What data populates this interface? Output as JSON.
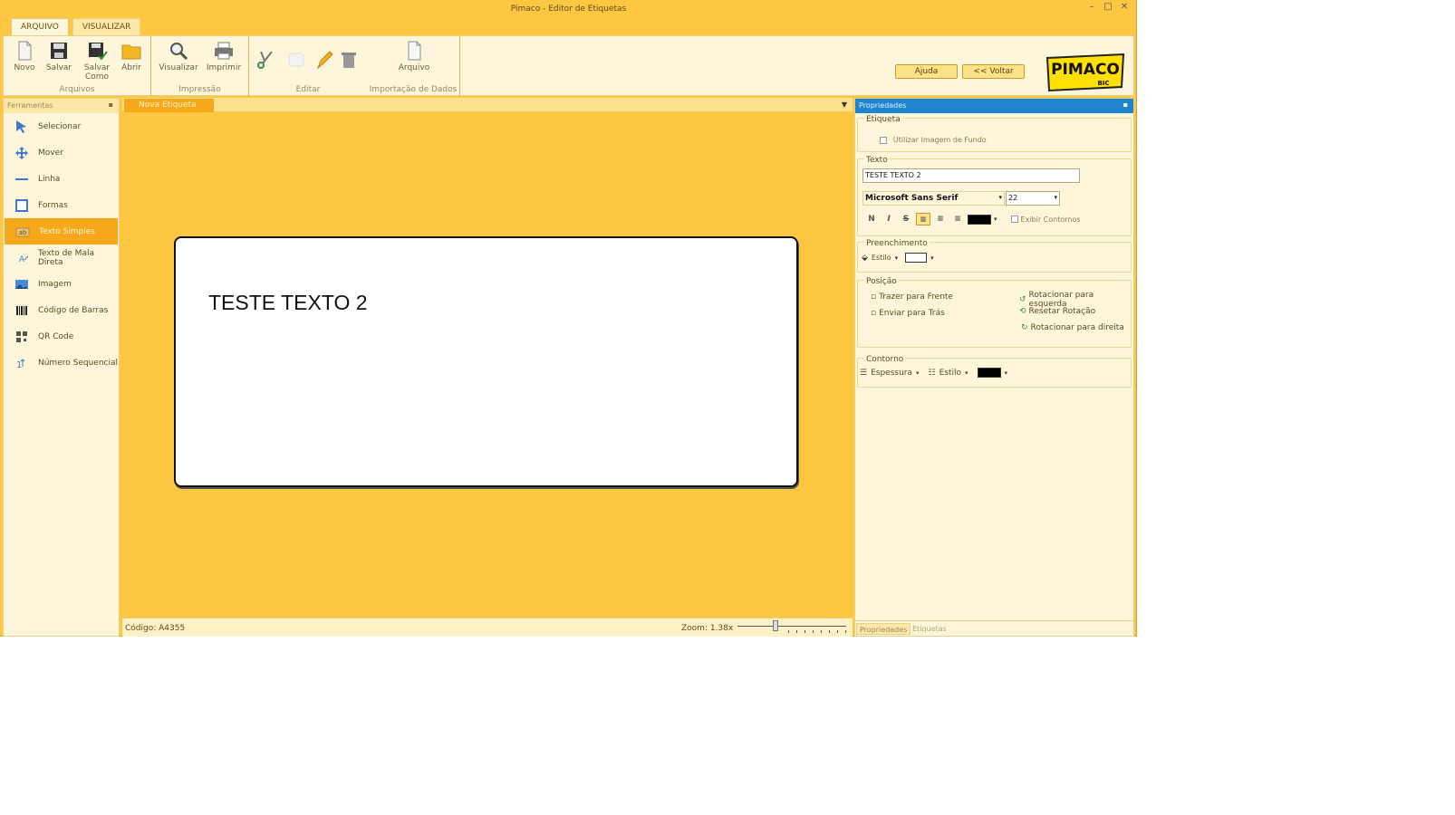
{
  "window": {
    "title": "Pimaco - Editor de Etiquetas",
    "controls": [
      "minimize",
      "maximize",
      "close"
    ]
  },
  "ribbon": {
    "tabs": [
      {
        "label": "ARQUIVO",
        "active": true
      },
      {
        "label": "VISUALIZAR",
        "active": false
      }
    ],
    "groups": {
      "arquivos": {
        "label": "Arquivos",
        "buttons": [
          "Novo",
          "Salvar",
          "Salvar Como",
          "Abrir"
        ]
      },
      "impressao": {
        "label": "Impressão",
        "buttons": [
          "Visualizar",
          "Imprimir"
        ]
      },
      "editar": {
        "label": "Editar"
      },
      "importacao": {
        "label": "Importação de Dados",
        "buttons": [
          "Arquivo"
        ]
      }
    },
    "help_label": "Ajuda",
    "back_label": "<< Voltar",
    "logo_text": "PIMACO",
    "logo_sub": "BIC"
  },
  "tools_panel": {
    "title": "Ferramentas",
    "items": [
      {
        "label": "Selecionar",
        "icon": "cursor-icon",
        "active": false
      },
      {
        "label": "Mover",
        "icon": "move-icon",
        "active": false
      },
      {
        "label": "Linha",
        "icon": "line-icon",
        "active": false
      },
      {
        "label": "Formas",
        "icon": "shape-icon",
        "active": false
      },
      {
        "label": "Texto Simples",
        "icon": "text-icon",
        "active": true
      },
      {
        "label": "Texto de Mala Direta",
        "icon": "mail-merge-icon",
        "active": false
      },
      {
        "label": "Imagem",
        "icon": "image-icon",
        "active": false
      },
      {
        "label": "Código de Barras",
        "icon": "barcode-icon",
        "active": false
      },
      {
        "label": "QR Code",
        "icon": "qrcode-icon",
        "active": false
      },
      {
        "label": "Número Sequencial",
        "icon": "sequence-icon",
        "active": false
      }
    ]
  },
  "document": {
    "tab_label": "Nova Etiqueta",
    "label_text": "TESTE TEXTO 2",
    "status_code": "Código: A4355",
    "status_zoom": "Zoom: 1.38x",
    "zoom_level": 0.38
  },
  "properties": {
    "title": "Propriedades",
    "etiqueta": {
      "title": "Etiqueta",
      "bg_image_label": "Utilizar Imagem de Fundo"
    },
    "texto": {
      "title": "Texto",
      "value": "TESTE TEXTO 2",
      "font": "Microsoft Sans Serif",
      "size": "22",
      "bold": "N",
      "italic": "I",
      "strike": "S",
      "show_outline_label": "Exibir Contornos"
    },
    "preenchimento": {
      "title": "Preenchimento",
      "style_label": "Estilo"
    },
    "posicao": {
      "title": "Posição",
      "bring_front": "Trazer para Frente",
      "send_back": "Enviar para Trás",
      "rotate_left": "Rotacionar para esquerda",
      "reset_rotation": "Resetar Rotação",
      "rotate_right": "Rotacionar para direita"
    },
    "contorno": {
      "title": "Contorno",
      "thickness_label": "Espessura",
      "style_label": "Estilo"
    },
    "bottom_tabs": [
      "Propriedades",
      "Etiquetas"
    ]
  },
  "colors": {
    "app_bg": "#FDC741",
    "active_orange": "#F7A81A",
    "panel_bg": "#FEF6DB",
    "prop_header": "#1E84CF"
  }
}
